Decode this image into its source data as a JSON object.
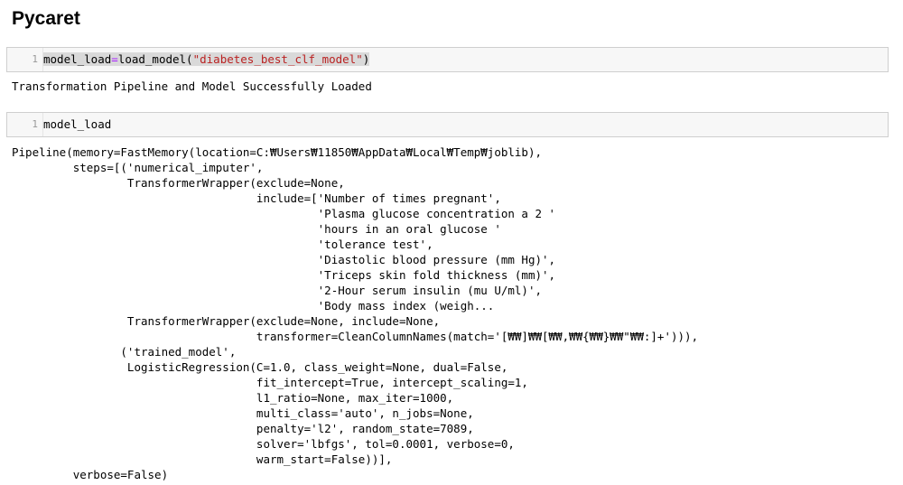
{
  "page": {
    "heading": "Pycaret"
  },
  "cells": [
    {
      "line_number": "1",
      "code_prefix": "model_load",
      "code_operator": "=",
      "code_call": "load_model(",
      "code_string": "\"diabetes_best_clf_model\"",
      "code_suffix": ")",
      "output": "Transformation Pipeline and Model Successfully Loaded"
    },
    {
      "line_number": "1",
      "code": "model_load",
      "output_lines": [
        "Pipeline(memory=FastMemory(location=C:₩Users₩11850₩AppData₩Local₩Temp₩joblib),",
        "         steps=[('numerical_imputer',",
        "                 TransformerWrapper(exclude=None,",
        "                                    include=['Number of times pregnant',",
        "                                             'Plasma glucose concentration a 2 '",
        "                                             'hours in an oral glucose '",
        "                                             'tolerance test',",
        "                                             'Diastolic blood pressure (mm Hg)',",
        "                                             'Triceps skin fold thickness (mm)',",
        "                                             '2-Hour serum insulin (mu U/ml)',",
        "                                             'Body mass index (weigh...",
        "                 TransformerWrapper(exclude=None, include=None,",
        "                                    transformer=CleanColumnNames(match='[₩₩]₩₩[₩₩,₩₩{₩₩}₩₩\"₩₩:]+'))),",
        "                ('trained_model',",
        "                 LogisticRegression(C=1.0, class_weight=None, dual=False,",
        "                                    fit_intercept=True, intercept_scaling=1,",
        "                                    l1_ratio=None, max_iter=1000,",
        "                                    multi_class='auto', n_jobs=None,",
        "                                    penalty='l2', random_state=7089,",
        "                                    solver='lbfgs', tol=0.0001, verbose=0,",
        "                                    warm_start=False))],",
        "         verbose=False)"
      ]
    }
  ]
}
